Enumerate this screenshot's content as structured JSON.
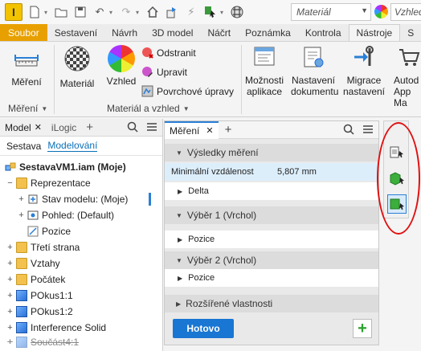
{
  "qat": {
    "app_letter": "I",
    "material_placeholder": "Materiál",
    "appearance_placeholder": "Vzhled"
  },
  "tabs": [
    "Soubor",
    "Sestavení",
    "Návrh",
    "3D model",
    "Náčrt",
    "Poznámka",
    "Kontrola",
    "Nástroje",
    "S"
  ],
  "active_tab": "Nástroje",
  "ribbon": {
    "measure_label": "Měření",
    "material_label": "Materiál",
    "appearance_label": "Vzhled",
    "remove_label": "Odstranit",
    "edit_label": "Upravit",
    "surface_label": "Povrchové úpravy",
    "app_options_label": "Možnosti aplikace",
    "doc_settings_label": "Nastavení dokumentu",
    "migrate_label": "Migrace nastavení",
    "appstore_label": "Autod App Ma",
    "panel_measure": "Měření",
    "panel_material": "Materiál a vzhled"
  },
  "browser": {
    "tab_model": "Model",
    "tab_ilogic": "iLogic",
    "sub_assembly": "Sestava",
    "sub_modeling": "Modelování",
    "items": [
      {
        "label": "SestavaVM1.iam (Moje)"
      },
      {
        "label": "Reprezentace"
      },
      {
        "label": "Stav modelu: (Moje)"
      },
      {
        "label": "Pohled: (Default)"
      },
      {
        "label": "Pozice"
      },
      {
        "label": "Třetí strana"
      },
      {
        "label": "Vztahy"
      },
      {
        "label": "Počátek"
      },
      {
        "label": "POkus1:1"
      },
      {
        "label": "POkus1:2"
      },
      {
        "label": "Interference Solid"
      },
      {
        "label": "Součást4:1"
      }
    ]
  },
  "measure": {
    "tab_label": "Měření",
    "results_header": "Výsledky měření",
    "min_distance_label": "Minimální vzdálenost",
    "min_distance_value": "5,807 mm",
    "delta_label": "Delta",
    "sel1_header": "Výběr 1 (Vrchol)",
    "sel1_position": "Pozice",
    "sel2_header": "Výběr 2 (Vrchol)",
    "sel2_position": "Pozice",
    "advanced_header": "Rozšířené vlastnosti",
    "done_label": "Hotovo",
    "add_label": "+"
  },
  "colors": {
    "accent": "#1976d2",
    "file_tab": "#e8a000",
    "highlight": "#ddeefb",
    "annotation": "#e01010"
  }
}
